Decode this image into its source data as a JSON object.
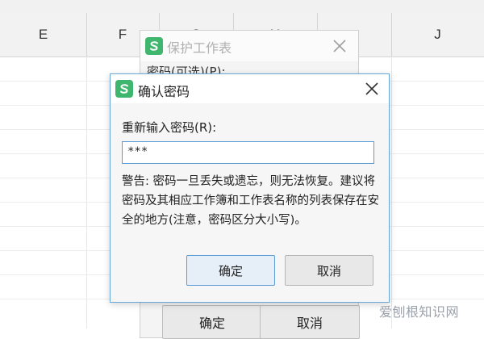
{
  "sheet": {
    "columns": [
      "E",
      "F",
      "G",
      "H",
      "",
      "J"
    ]
  },
  "background_dialog": {
    "title": "保护工作表",
    "password_label": "密码(可选)(P):",
    "ok_label": "确定",
    "cancel_label": "取消"
  },
  "dialog": {
    "title": "确认密码",
    "prompt": "重新输入密码(R):",
    "password_value": "***",
    "warning": "警告: 密码一旦丢失或遗忘，则无法恢复。建议将密码及其相应工作簿和工作表名称的列表保存在安全的地方(注意，密码区分大小写)。",
    "ok_label": "确定",
    "cancel_label": "取消"
  },
  "watermark": "爱刨根知识网",
  "colors": {
    "logo_green": "#3fb66d",
    "focus_blue": "#5b9bd5",
    "dialog_border": "#6aa7d6"
  },
  "icons": [
    "wps-logo-icon",
    "close-icon"
  ]
}
